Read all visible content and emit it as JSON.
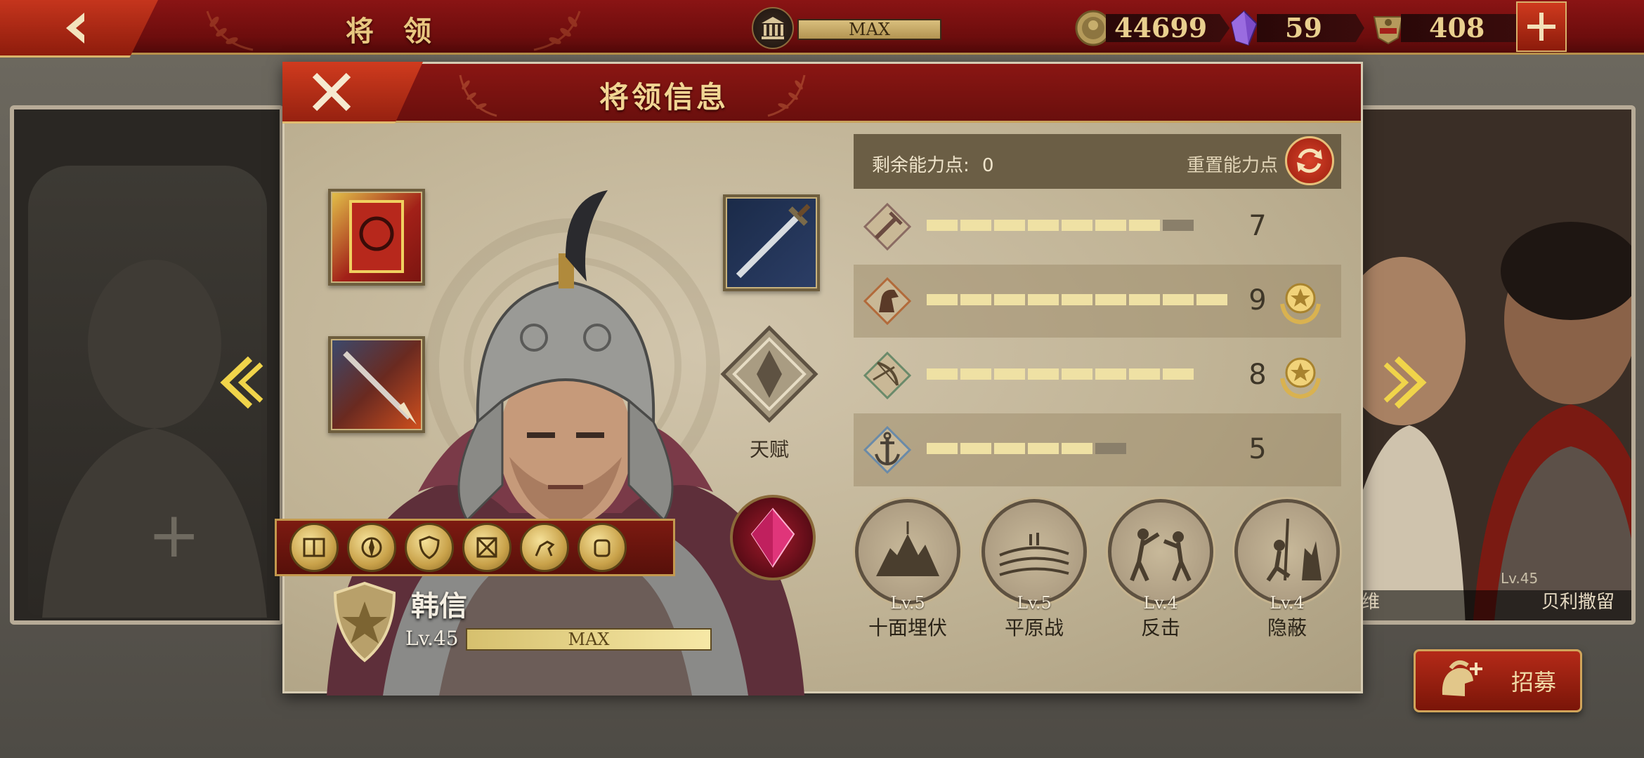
{
  "topbar": {
    "title": "将 领",
    "building_level": "MAX",
    "resources": [
      {
        "icon": "coin-icon",
        "value": "44699"
      },
      {
        "icon": "crystal-icon",
        "value": "59"
      },
      {
        "icon": "spqr-emblem-icon",
        "value": "408"
      }
    ]
  },
  "background": {
    "right_hero_names": [
      "维",
      "贝利撒留"
    ],
    "right_hero_level": "Lv.45",
    "recruit_label": "招募"
  },
  "modal": {
    "title": "将领信息",
    "talent_label": "天赋",
    "hero": {
      "name": "韩信",
      "level": "Lv.45",
      "exp_label": "MAX"
    },
    "points": {
      "remaining_label": "剩余能力点:",
      "remaining_value": "0",
      "reset_label": "重置能力点"
    },
    "stats": [
      {
        "icon": "sword-icon",
        "value": "7",
        "fill": 7,
        "max": 8,
        "medal": false
      },
      {
        "icon": "horse-icon",
        "value": "9",
        "fill": 9,
        "max": 9,
        "medal": true
      },
      {
        "icon": "bow-icon",
        "value": "8",
        "fill": 8,
        "max": 8,
        "medal": true
      },
      {
        "icon": "anchor-icon",
        "value": "5",
        "fill": 5,
        "max": 6,
        "medal": false
      }
    ],
    "skills": [
      {
        "level": "Lv.5",
        "name": "十面埋伏"
      },
      {
        "level": "Lv.5",
        "name": "平原战"
      },
      {
        "level": "Lv.4",
        "name": "反击"
      },
      {
        "level": "Lv.4",
        "name": "隐蔽"
      }
    ]
  },
  "colors": {
    "header_red": "#8a1613",
    "gold": "#e8c780",
    "parchment": "#c0b395",
    "bar_fill": "#efe1a4"
  }
}
